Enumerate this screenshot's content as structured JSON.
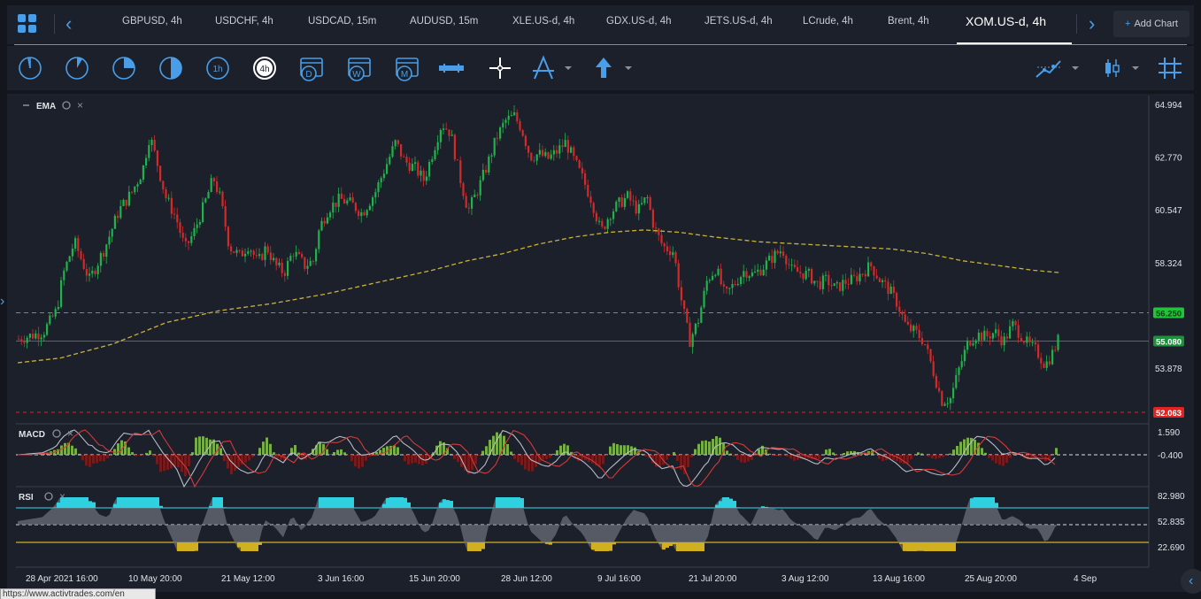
{
  "tabs": [
    {
      "label": "GBPUSD, 4h",
      "active": false
    },
    {
      "label": "USDCHF, 4h",
      "active": false
    },
    {
      "label": "USDCAD, 15m",
      "active": false
    },
    {
      "label": "AUDUSD, 15m",
      "active": false
    },
    {
      "label": "XLE.US-d, 4h",
      "active": false
    },
    {
      "label": "GDX.US-d, 4h",
      "active": false
    },
    {
      "label": "JETS.US-d, 4h",
      "active": false
    },
    {
      "label": "LCrude, 4h",
      "active": false
    },
    {
      "label": "Brent, 4h",
      "active": false
    },
    {
      "label": "XOM.US-d, 4h",
      "active": true
    }
  ],
  "add_chart_label": "Add Chart",
  "toolbar": {
    "timeframe_icons": [
      "clock-1m-icon",
      "clock-5m-icon",
      "clock-15m-icon",
      "clock-30m-icon",
      "clock-1h-icon",
      "clock-4h-icon",
      "calendar-day-icon",
      "calendar-week-icon",
      "calendar-month-icon"
    ],
    "timeframe_labels": [
      "1h",
      "4h",
      "D",
      "W",
      "M"
    ],
    "tool_icons": [
      "ruler-icon",
      "crosshair-icon",
      "draw-tool-icon",
      "arrow-up-icon"
    ],
    "right_icons": [
      "indicator-icon",
      "candle-type-icon",
      "grid-icon"
    ]
  },
  "panels": {
    "main": {
      "indicator": "EMA"
    },
    "macd": {
      "indicator": "MACD"
    },
    "rsi": {
      "indicator": "RSI"
    }
  },
  "price_axis": [
    "64.994",
    "62.770",
    "60.547",
    "58.324",
    "53.878"
  ],
  "price_tags": {
    "resistance": {
      "value": "56.250",
      "color": "#22c33a"
    },
    "current": {
      "value": "55.080",
      "color": "#1e8f3a"
    },
    "support": {
      "value": "52.063",
      "color": "#e02424"
    }
  },
  "macd_axis": [
    "1.590",
    "-0.400"
  ],
  "rsi_axis": [
    "82.980",
    "52.835",
    "22.690"
  ],
  "time_axis": [
    "28 Apr 2021 16:00",
    "10 May 20:00",
    "21 May 12:00",
    "3 Jun 16:00",
    "15 Jun 20:00",
    "28 Jun 12:00",
    "9 Jul 16:00",
    "21 Jul 20:00",
    "3 Aug 12:00",
    "13 Aug 16:00",
    "25 Aug 20:00",
    "4 Sep"
  ],
  "colors": {
    "up": "#22b24c",
    "down": "#d02a2a",
    "ema": "#c9b23a",
    "accent": "#4a9ee8"
  },
  "status_url": "https://www.activtrades.com/en"
}
